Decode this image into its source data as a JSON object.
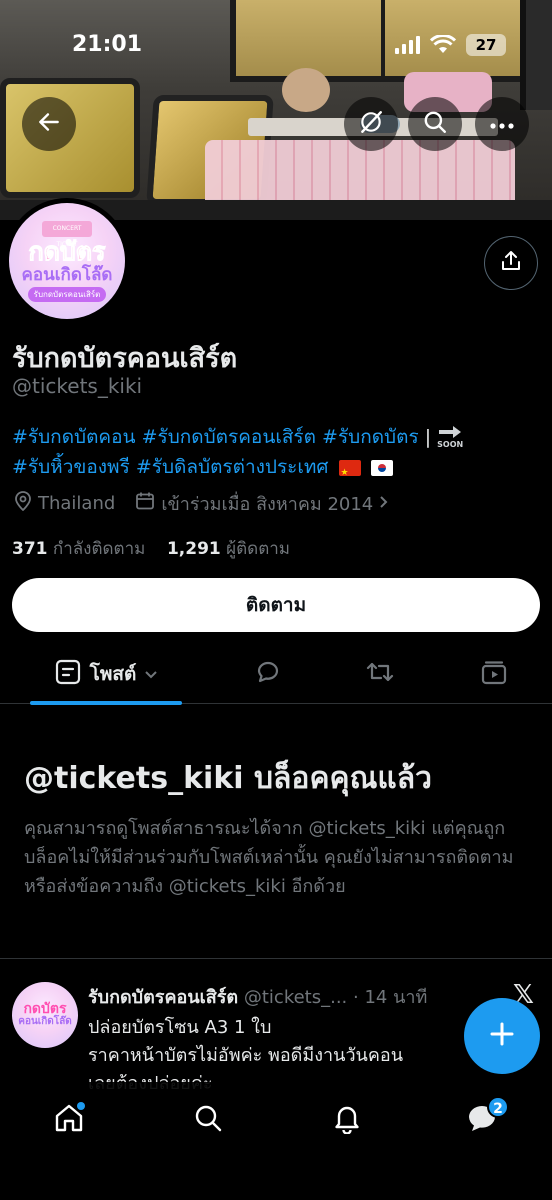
{
  "status_bar": {
    "time": "21:01",
    "battery": "27"
  },
  "profile": {
    "display_name": "รับกดบัตรคอนเสิร์ต",
    "handle": "@tickets_kiki",
    "avatar": {
      "ticket": "CONCERT TICKET",
      "line1": "กดบัตร",
      "line2": "คอนเกิดโล๊ด",
      "pill": "รับกดบัตรคอนเสิร์ต"
    },
    "bio": {
      "line1": [
        "#รับกดบัตคอน",
        "#รับกดบัตรคอนเสิร์ต",
        "#รับกดบัตร"
      ],
      "pipe": "|",
      "soon": "SOON",
      "line2": [
        "#รับหิ้วของพรี",
        "#รับดิลบัตรต่างประเทศ"
      ]
    },
    "location": "Thailand",
    "joined": "เข้าร่วมเมื่อ สิงหาคม 2014",
    "following_count": "371",
    "following_label": "กำลังติดตาม",
    "followers_count": "1,291",
    "followers_label": "ผู้ติดตาม",
    "follow_button": "ติดตาม"
  },
  "tabs": {
    "posts_label": "โพสต์"
  },
  "blocked": {
    "title": "@tickets_kiki บล็อคคุณแล้ว",
    "description": "คุณสามารถดูโพสต์สาธารณะได้จาก @tickets_kiki แต่คุณถูกบล็อคไม่ให้มีส่วนร่วมกับโพสต์เหล่านั้น คุณยังไม่สามารถติดตามหรือส่งข้อความถึง @tickets_kiki อีกด้วย"
  },
  "tweet": {
    "name": "รับกดบัตรคอนเสิร์ต",
    "handle": "@tickets_...",
    "time": "· 14 นาที",
    "line1": "ปล่อยบัตรโซน A3 1 ใบ",
    "line2": "ราคาหน้าบัตรไม่อัพค่ะ พอดีมีงานวันคอน",
    "line3": "เลยต้องปล่อยค่ะ"
  },
  "bottom_nav": {
    "messages_badge": "2"
  },
  "colors": {
    "accent": "#1d9bf0",
    "background": "#000000",
    "text": "#e7e9ea",
    "muted": "#71767b"
  }
}
